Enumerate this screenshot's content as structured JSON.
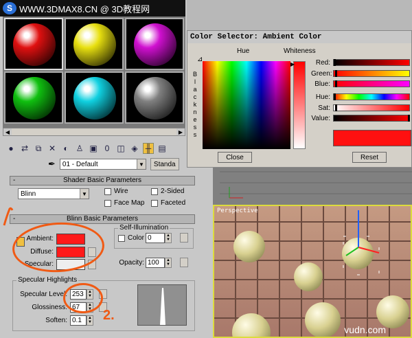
{
  "header": {
    "logo_glyph": "S",
    "watermark": "WWW.3DMAX8.CN @ 3D教程网"
  },
  "material_slots": [
    {
      "color": "#e01010"
    },
    {
      "color": "#e8e010"
    },
    {
      "color": "#d010d0"
    },
    {
      "color": "#10c010"
    },
    {
      "color": "#10d0e0"
    },
    {
      "color": "#808080"
    }
  ],
  "material_selector": {
    "name": "01 - Default",
    "type_button": "Standa"
  },
  "shader_rollout": {
    "title": "Shader Basic Parameters",
    "shader": "Blinn",
    "options": {
      "wire": "Wire",
      "two_sided": "2-Sided",
      "face_map": "Face Map",
      "faceted": "Faceted"
    }
  },
  "blinn_rollout": {
    "title": "Blinn Basic Parameters",
    "ambient_label": "Ambient:",
    "ambient_color": "#ff1a1a",
    "diffuse_label": "Diffuse:",
    "diffuse_color": "#ff1a1a",
    "specular_label": "Specular:",
    "specular_color": "#eeeeee",
    "self_illum": {
      "title": "Self-Illumination",
      "color_label": "Color",
      "value": "0"
    },
    "opacity": {
      "label": "Opacity:",
      "value": "100"
    },
    "specular_highlights": {
      "title": "Specular Highlights",
      "level_label": "Specular Level:",
      "level_value": "253",
      "gloss_label": "Glossiness:",
      "gloss_value": "67",
      "soften_label": "Soften:",
      "soften_value": "0.1"
    },
    "annotation_2": "2."
  },
  "color_selector": {
    "title": "Color Selector: Ambient Color",
    "hue_label": "Hue",
    "whiteness_label": "Whiteness",
    "blackness_label": "Blackness",
    "channels": [
      {
        "label": "Red:",
        "fraction": 0.0
      },
      {
        "label": "Green:",
        "fraction": 0.02
      },
      {
        "label": "Blue:",
        "fraction": 0.02
      },
      {
        "label": "Hue:",
        "fraction": 0.0
      },
      {
        "label": "Sat:",
        "fraction": 0.02
      },
      {
        "label": "Value:",
        "fraction": 1.0
      }
    ],
    "close_label": "Close",
    "reset_label": "Reset",
    "preview_color": "#ff1010"
  },
  "viewport": {
    "label": "Perspective",
    "watermark": "vudn.com"
  }
}
